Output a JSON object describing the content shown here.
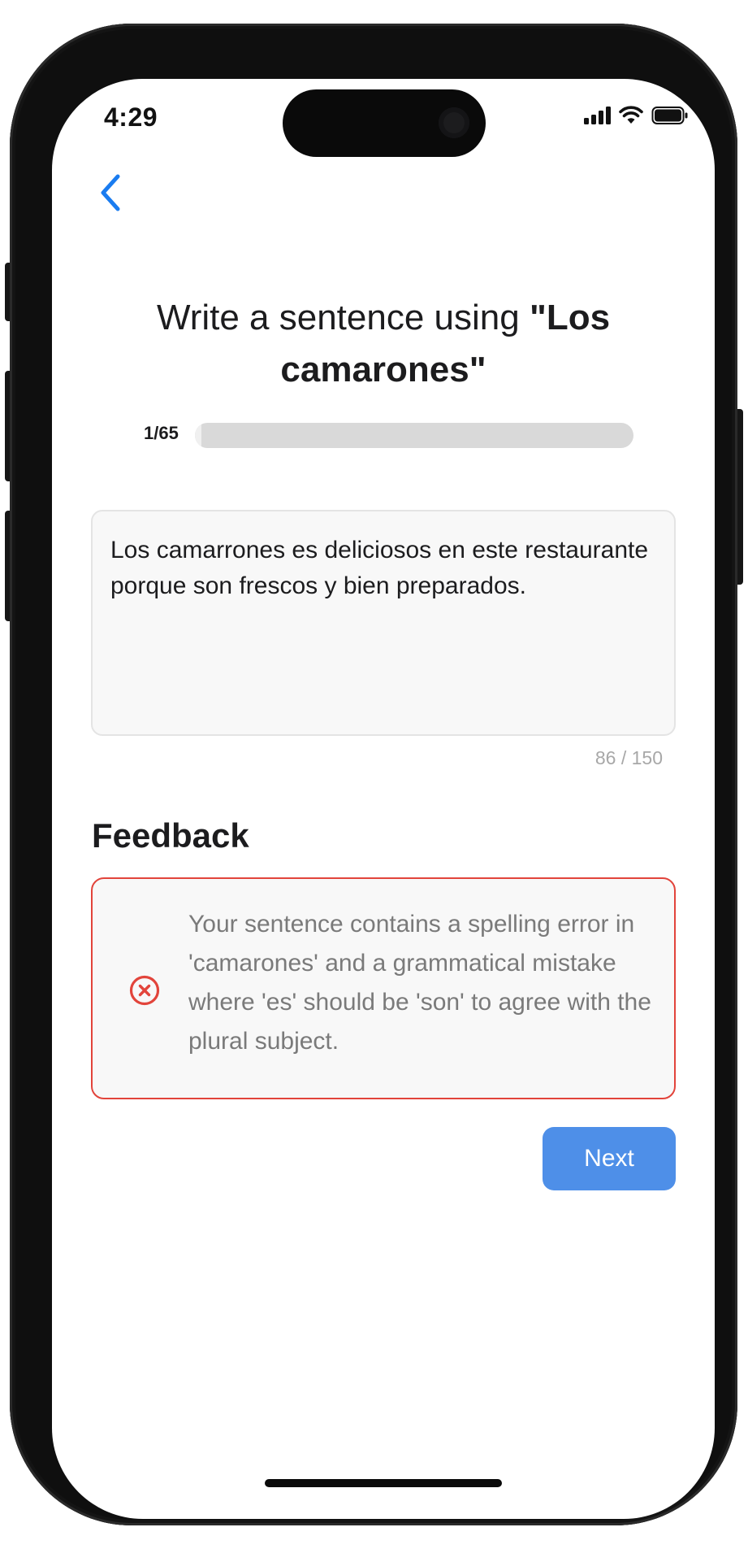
{
  "status_bar": {
    "time": "4:29",
    "icons": [
      "signal-icon",
      "wifi-icon",
      "battery-icon"
    ]
  },
  "nav": {
    "back_icon": "chevron-left-icon",
    "accent_color": "#1a7cf0"
  },
  "prompt": {
    "prefix": "Write a sentence using ",
    "phrase": "\"Los camarones\""
  },
  "progress": {
    "label": "1/65",
    "current": 1,
    "total": 65
  },
  "answer": {
    "text": "Los camarrones es deliciosos en este restaurante porque son frescos y bien preparados.",
    "char_count": "86 / 150"
  },
  "feedback": {
    "heading": "Feedback",
    "status": "error",
    "status_icon": "error-circle-icon",
    "status_color": "#e2443b",
    "message": "Your sentence contains a spelling error in 'camarones' and a grammatical mistake where 'es' should be 'son' to agree with the plural subject."
  },
  "actions": {
    "next_label": "Next",
    "next_color": "#4e8fe8"
  }
}
